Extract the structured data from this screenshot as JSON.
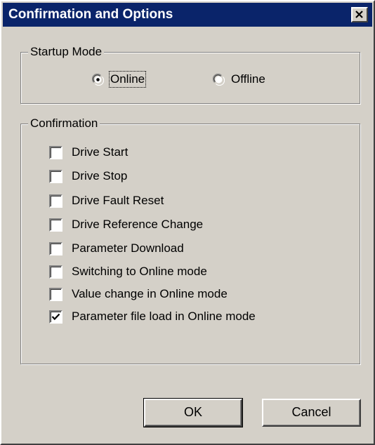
{
  "window": {
    "title": "Confirmation and Options",
    "close_icon": "close-icon"
  },
  "startup_mode": {
    "legend": "Startup Mode",
    "options": [
      {
        "label": "Online",
        "selected": true
      },
      {
        "label": "Offline",
        "selected": false
      }
    ]
  },
  "confirmation": {
    "legend": "Confirmation",
    "items": [
      {
        "label": "Drive Start",
        "checked": false
      },
      {
        "label": "Drive Stop",
        "checked": false
      },
      {
        "label": "Drive Fault Reset",
        "checked": false
      },
      {
        "label": "Drive Reference Change",
        "checked": false
      },
      {
        "label": "Parameter Download",
        "checked": false
      },
      {
        "label": "Switching to Online mode",
        "checked": false
      },
      {
        "label": "Value change in Online mode",
        "checked": false
      },
      {
        "label": "Parameter file load in Online mode",
        "checked": true
      }
    ]
  },
  "buttons": {
    "ok_label": "OK",
    "cancel_label": "Cancel"
  }
}
